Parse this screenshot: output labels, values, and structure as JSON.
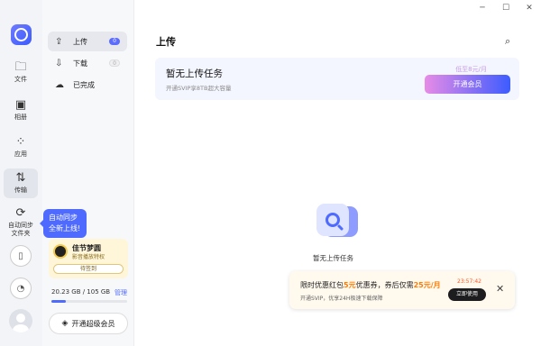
{
  "window": {
    "minimize": "─",
    "maximize": "☐",
    "close": "✕"
  },
  "rail": {
    "items": [
      {
        "label": "文件",
        "icon": "folder-icon",
        "glyph": "🗀"
      },
      {
        "label": "相册",
        "icon": "photo-icon",
        "glyph": "▣"
      },
      {
        "label": "应用",
        "icon": "apps-icon",
        "glyph": "⁘"
      },
      {
        "label": "传输",
        "icon": "transfer-icon",
        "glyph": "⇅"
      },
      {
        "label": "自动同步\n文件夹",
        "icon": "sync-icon",
        "glyph": "⟳"
      }
    ]
  },
  "tooltip": {
    "line1": "自动同步",
    "line2": "全新上线!"
  },
  "nav": {
    "upload": {
      "label": "上传",
      "badge": "0"
    },
    "download": {
      "label": "下载",
      "badge": "0"
    },
    "done": {
      "label": "已完成"
    }
  },
  "promo": {
    "title": "佳节梦圆",
    "sub": "影音播放特权",
    "button": "待签到"
  },
  "storage": {
    "text": "20.23 GB / 105 GB",
    "manage": "管理",
    "used_fraction": 0.193
  },
  "svip_button": "开通超级会员",
  "main": {
    "title": "上传",
    "banner_title": "暂无上传任务",
    "banner_sub": "开通SVIP享8TB超大容量",
    "price": "低至8元/月",
    "open_button": "开通会员",
    "empty_text": "暂无上传任务"
  },
  "toast": {
    "line1_pre": "限时优惠红包",
    "line1_hl1": "5元",
    "line1_mid": "优惠券，券后仅需",
    "line1_hl2": "25元/月",
    "line2": "开通SVIP，优享24H极速下载保障",
    "timer": "23:57:42",
    "button": "立即使用"
  },
  "colors": {
    "accent": "#4f6bff",
    "promo_bg": "#fff6d9",
    "toast_bg": "#fff9ee"
  }
}
